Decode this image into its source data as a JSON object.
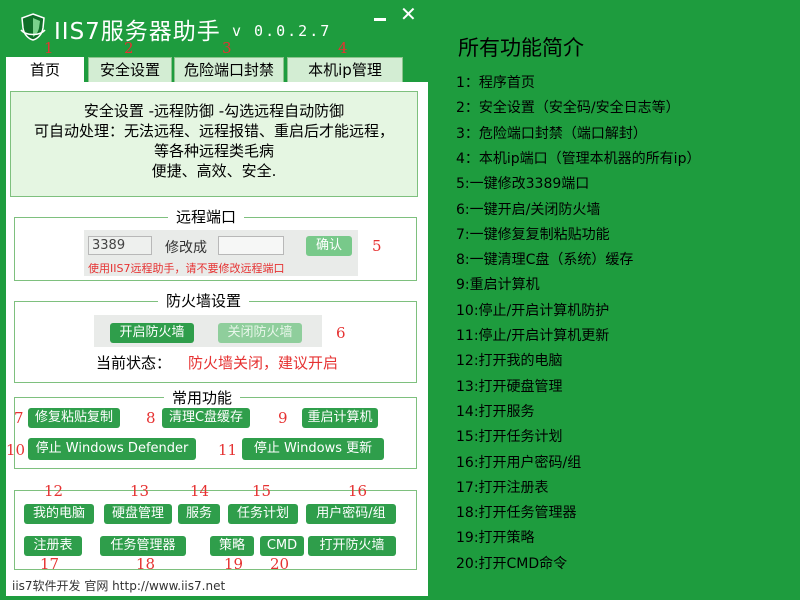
{
  "app": {
    "title": "IIS7服务器助手",
    "version": "v 0.0.2.7",
    "close_glyph": "✕",
    "colors": {
      "brand_green": "#1e9c3e",
      "accent_red": "#e63232",
      "button_green": "#2f9e4b",
      "panel_green": "#e5f6e2"
    }
  },
  "tabs": [
    {
      "label": "首页",
      "num": "1"
    },
    {
      "label": "安全设置",
      "num": "2"
    },
    {
      "label": "危险端口封禁",
      "num": "3"
    },
    {
      "label": "本机ip管理",
      "num": "4"
    }
  ],
  "intro": {
    "lines": [
      "安全设置 -远程防御 -勾选远程自动防御",
      "可自动处理：无法远程、远程报错、重启后才能远程，",
      "等各种远程类毛病",
      "便捷、高效、安全."
    ]
  },
  "remote_port": {
    "title": "远程端口",
    "current_value": "3389",
    "change_label": "修改成",
    "new_value": "",
    "confirm_label": "确认",
    "warning": "使用IIS7远程助手，请不要修改远程端口",
    "num": "5"
  },
  "firewall": {
    "title": "防火墙设置",
    "enable_label": "开启防火墙",
    "disable_label": "关闭防火墙",
    "num": "6",
    "status_label": "当前状态：",
    "status_value": "防火墙关闭，建议开启"
  },
  "common": {
    "title": "常用功能",
    "buttons": [
      {
        "label": "修复粘贴复制",
        "num": "7"
      },
      {
        "label": "清理C盘缓存",
        "num": "8"
      },
      {
        "label": "重启计算机",
        "num": "9"
      },
      {
        "label": "停止 Windows Defender",
        "num": "10"
      },
      {
        "label": "停止 Windows 更新",
        "num": "11"
      }
    ]
  },
  "shortcuts": {
    "buttons": [
      {
        "label": "我的电脑",
        "num": "12"
      },
      {
        "label": "硬盘管理",
        "num": "13"
      },
      {
        "label": "服务",
        "num": "14"
      },
      {
        "label": "任务计划",
        "num": "15"
      },
      {
        "label": "用户密码/组",
        "num": "16"
      },
      {
        "label": "注册表",
        "num": "17"
      },
      {
        "label": "任务管理器",
        "num": "18"
      },
      {
        "label": "策略",
        "num": "19"
      },
      {
        "label": "CMD",
        "num": "20"
      },
      {
        "label": "打开防火墙",
        "num": ""
      }
    ]
  },
  "footer": {
    "text": "iis7软件开发  官网  http://www.iis7.net"
  },
  "help": {
    "title": "所有功能简介",
    "items": [
      "1：程序首页",
      "2：安全设置（安全码/安全日志等）",
      "3：危险端口封禁（端口解封）",
      "4：本机ip端口（管理本机器的所有ip）",
      "5:一键修改3389端口",
      "6:一键开启/关闭防火墙",
      "7:一键修复复制粘贴功能",
      "8:一键清理C盘（系统）缓存",
      "9:重启计算机",
      "10:停止/开启计算机防护",
      "11:停止/开启计算机更新",
      "12:打开我的电脑",
      "13:打开硬盘管理",
      "14:打开服务",
      "15:打开任务计划",
      "16:打开用户密码/组",
      "17:打开注册表",
      "18:打开任务管理器",
      "19:打开策略",
      "20:打开CMD命令"
    ]
  }
}
